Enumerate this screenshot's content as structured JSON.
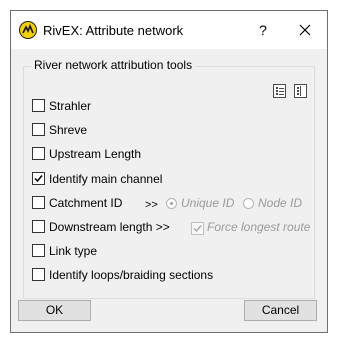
{
  "window": {
    "title": "RivEX: Attribute network",
    "help_label": "?"
  },
  "group": {
    "label": "River network attribution tools"
  },
  "options": [
    {
      "label": "Strahler",
      "checked": false
    },
    {
      "label": "Shreve",
      "checked": false
    },
    {
      "label": "Upstream Length",
      "checked": false
    },
    {
      "label": "Identify main channel",
      "checked": true
    },
    {
      "label": "Catchment ID",
      "checked": false
    },
    {
      "label": "Downstream length >>",
      "checked": false
    },
    {
      "label": "Link type",
      "checked": false
    },
    {
      "label": "Identify loops/braiding sections",
      "checked": false
    }
  ],
  "catchment": {
    "arrows": ">>",
    "unique_id_label": "Unique ID",
    "node_id_label": "Node ID",
    "selected": "Unique ID"
  },
  "downstream": {
    "force_longest_label": "Force longest route",
    "force_longest_checked": true
  },
  "icons": [
    "select-all-icon",
    "clear-all-icon"
  ],
  "buttons": {
    "ok": "OK",
    "cancel": "Cancel"
  }
}
